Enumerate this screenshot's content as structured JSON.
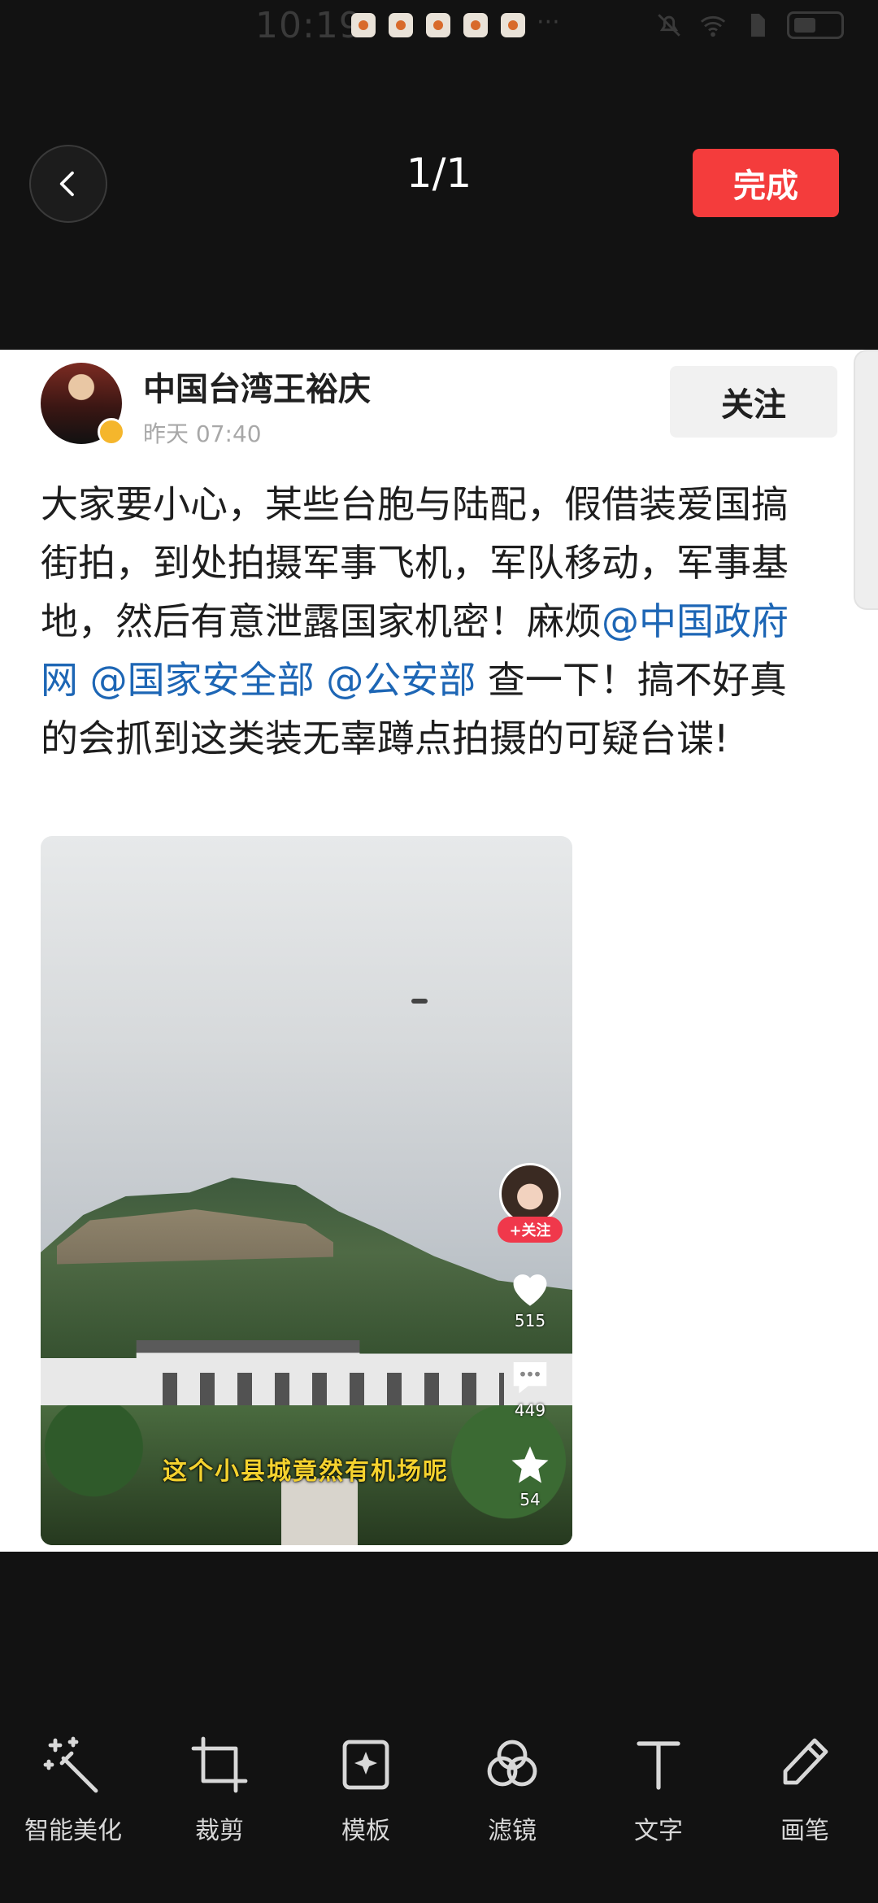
{
  "status_bar": {
    "time": "10:19",
    "notification_icons": [
      "app-notification-icon",
      "app-notification-icon",
      "app-notification-icon",
      "app-notification-icon",
      "app-notification-icon"
    ],
    "more": "···"
  },
  "header": {
    "page_counter": "1/1",
    "done_label": "完成",
    "done_color": "#f43c3c"
  },
  "post": {
    "author_name": "中国台湾王裕庆",
    "time": "昨天 07:40",
    "follow_label": "关注",
    "text_parts": {
      "p1": "大家要小心，某些台胞与陆配，假借装爱国搞街拍，到处拍摄军事飞机，军队移动，军事基地，然后有意泄露国家机密！麻烦",
      "m1": "@中国政府网",
      "m2": "@国家安全部",
      "m3": "@公安部",
      "p2": " 查一下！搞不好真的会抓到这类装无辜蹲点拍摄的可疑台谍!"
    },
    "mention_color": "#1d66b5",
    "video": {
      "caption": "这个小县城竟然有机场呢",
      "creator_follow": "+关注",
      "likes": "515",
      "comments": "449",
      "favorites": "54"
    }
  },
  "toolbar": {
    "items": [
      {
        "label": "智能美化",
        "icon": "magic-wand-icon"
      },
      {
        "label": "裁剪",
        "icon": "crop-icon"
      },
      {
        "label": "模板",
        "icon": "template-icon"
      },
      {
        "label": "滤镜",
        "icon": "filter-icon"
      },
      {
        "label": "文字",
        "icon": "text-icon"
      },
      {
        "label": "画笔",
        "icon": "pen-icon"
      }
    ]
  }
}
